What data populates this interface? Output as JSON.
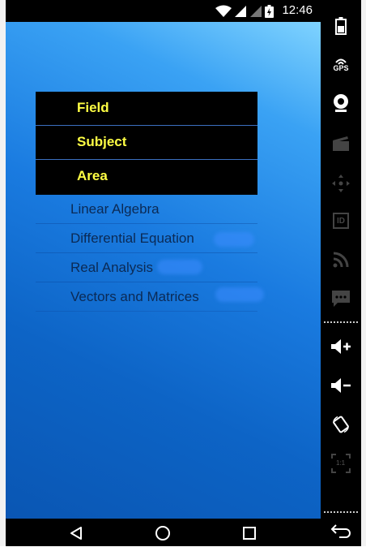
{
  "status_bar": {
    "time": "12:46"
  },
  "menu": {
    "items": [
      {
        "label": "Field"
      },
      {
        "label": "Subject"
      },
      {
        "label": "Area"
      }
    ]
  },
  "list": {
    "items": [
      {
        "label": "Linear Algebra"
      },
      {
        "label": "Differential Equation"
      },
      {
        "label": "Real Analysis"
      },
      {
        "label": "Vectors and Matrices"
      }
    ]
  },
  "toolbar": {
    "buttons": [
      {
        "icon": "battery-icon"
      },
      {
        "icon": "gps-icon",
        "label": "GPS"
      },
      {
        "icon": "camera-icon"
      },
      {
        "icon": "media-icon"
      },
      {
        "icon": "dpad-icon"
      },
      {
        "icon": "id-icon",
        "label": "ID"
      },
      {
        "icon": "rss-icon"
      },
      {
        "icon": "sms-icon"
      },
      {
        "icon": "volume-up-icon"
      },
      {
        "icon": "volume-down-icon"
      },
      {
        "icon": "rotate-icon"
      },
      {
        "icon": "pixel-ratio-icon",
        "label": "1:1"
      },
      {
        "icon": "back-arrow-icon"
      }
    ]
  },
  "colors": {
    "menu_text": "#ffff44",
    "list_text": "#0b2a55",
    "gradient_light": "#7fd3ff",
    "gradient_dark": "#0a56b3"
  }
}
